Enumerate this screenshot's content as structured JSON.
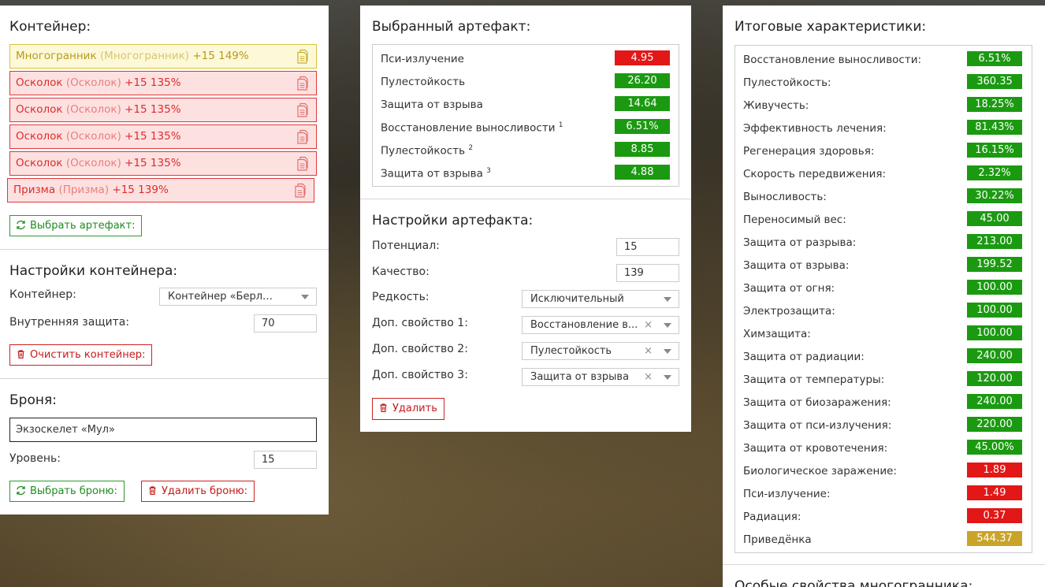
{
  "container": {
    "title": "Контейнер:",
    "slots": [
      {
        "name": "Многогранник",
        "sub": "(Многогранник)",
        "level": "+15 149%",
        "color": "gold"
      },
      {
        "name": "Осколок",
        "sub": "(Осколок)",
        "level": "+15 135%",
        "color": "red"
      },
      {
        "name": "Осколок",
        "sub": "(Осколок)",
        "level": "+15 135%",
        "color": "red"
      },
      {
        "name": "Осколок",
        "sub": "(Осколок)",
        "level": "+15 135%",
        "color": "red"
      },
      {
        "name": "Осколок",
        "sub": "(Осколок)",
        "level": "+15 135%",
        "color": "red"
      },
      {
        "name": "Призма",
        "sub": "(Призма)",
        "level": "+15 139%",
        "color": "red"
      }
    ],
    "select_artifact_button": "Выбрать артефакт:"
  },
  "container_settings": {
    "title": "Настройки контейнера:",
    "container_label": "Контейнер:",
    "container_value": "Контейнер «Берлога...",
    "inner_protection_label": "Внутренняя защита:",
    "inner_protection_value": "70",
    "clear_button": "Очистить контейнер:"
  },
  "armor": {
    "title": "Броня:",
    "name_value": "Экзоскелет «Мул»",
    "level_label": "Уровень:",
    "level_value": "15",
    "select_button": "Выбрать броню:",
    "delete_button": "Удалить броню:"
  },
  "selected_artifact": {
    "title": "Выбранный артефакт:",
    "stats": [
      {
        "name": "Пси-излучение",
        "sup": "",
        "value": "4.95",
        "color": "red"
      },
      {
        "name": "Пулестойкость",
        "sup": "",
        "value": "26.20",
        "color": "green"
      },
      {
        "name": "Защита от взрыва",
        "sup": "",
        "value": "14.64",
        "color": "green"
      },
      {
        "name": "Восстановление выносливости",
        "sup": "1",
        "value": "6.51%",
        "color": "green"
      },
      {
        "name": "Пулестойкость",
        "sup": "2",
        "value": "8.85",
        "color": "green"
      },
      {
        "name": "Защита от взрыва",
        "sup": "3",
        "value": "4.88",
        "color": "green"
      }
    ]
  },
  "artifact_settings": {
    "title": "Настройки артефакта:",
    "potential_label": "Потенциал:",
    "potential_value": "15",
    "quality_label": "Качество:",
    "quality_value": "139",
    "rarity_label": "Редкость:",
    "rarity_value": "Исключительный",
    "prop1_label": "Доп. свойство 1:",
    "prop1_value": "Восстановление в...",
    "prop2_label": "Доп. свойство 2:",
    "prop2_value": "Пулестойкость",
    "prop3_label": "Доп. свойство 3:",
    "prop3_value": "Защита от взрыва",
    "delete_button": "Удалить"
  },
  "totals": {
    "title": "Итоговые характеристики:",
    "stats": [
      {
        "name": "Восстановление выносливости:",
        "value": "6.51%",
        "color": "green"
      },
      {
        "name": "Пулестойкость:",
        "value": "360.35",
        "color": "green"
      },
      {
        "name": "Живучесть:",
        "value": "18.25%",
        "color": "green"
      },
      {
        "name": "Эффективность лечения:",
        "value": "81.43%",
        "color": "green"
      },
      {
        "name": "Регенерация здоровья:",
        "value": "16.15%",
        "color": "green"
      },
      {
        "name": "Скорость передвижения:",
        "value": "2.32%",
        "color": "green"
      },
      {
        "name": "Выносливость:",
        "value": "30.22%",
        "color": "green"
      },
      {
        "name": "Переносимый вес:",
        "value": "45.00",
        "color": "green"
      },
      {
        "name": "Защита от разрыва:",
        "value": "213.00",
        "color": "green"
      },
      {
        "name": "Защита от взрыва:",
        "value": "199.52",
        "color": "green"
      },
      {
        "name": "Защита от огня:",
        "value": "100.00",
        "color": "green"
      },
      {
        "name": "Электрозащита:",
        "value": "100.00",
        "color": "green"
      },
      {
        "name": "Химзащита:",
        "value": "100.00",
        "color": "green"
      },
      {
        "name": "Защита от радиации:",
        "value": "240.00",
        "color": "green"
      },
      {
        "name": "Защита от температуры:",
        "value": "120.00",
        "color": "green"
      },
      {
        "name": "Защита от биозаражения:",
        "value": "240.00",
        "color": "green"
      },
      {
        "name": "Защита от пси-излучения:",
        "value": "220.00",
        "color": "green"
      },
      {
        "name": "Защита от кровотечения:",
        "value": "45.00%",
        "color": "green"
      },
      {
        "name": "Биологическое заражение:",
        "value": "1.89",
        "color": "red"
      },
      {
        "name": "Пси-излучение:",
        "value": "1.49",
        "color": "red"
      },
      {
        "name": "Радиация:",
        "value": "0.37",
        "color": "red"
      },
      {
        "name": "Приведёнка",
        "value": "544.37",
        "color": "yellow"
      }
    ]
  },
  "special": {
    "title": "Особые свойства многогранника:"
  }
}
